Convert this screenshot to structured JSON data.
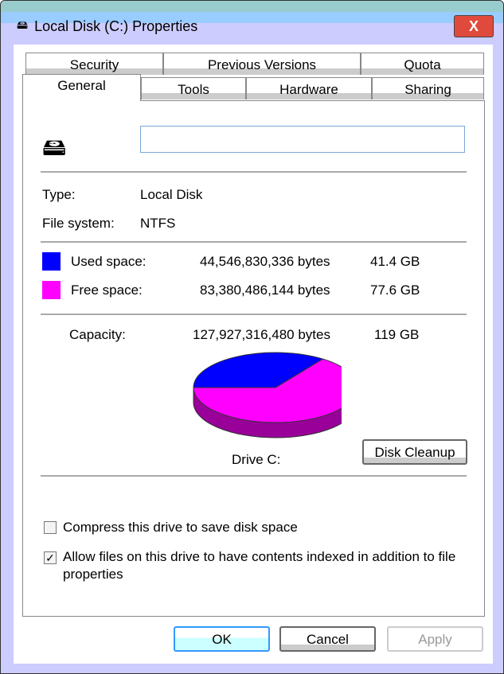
{
  "window": {
    "title": "Local Disk (C:) Properties",
    "close_label": "X"
  },
  "tabs": {
    "row1": [
      "Security",
      "Previous Versions",
      "Quota"
    ],
    "row2": [
      "General",
      "Tools",
      "Hardware",
      "Sharing"
    ],
    "active": "General"
  },
  "general": {
    "name_value": "",
    "type_label": "Type:",
    "type_value": "Local Disk",
    "fs_label": "File system:",
    "fs_value": "NTFS",
    "used_label": "Used space:",
    "used_bytes": "44,546,830,336 bytes",
    "used_gb": "41.4 GB",
    "used_color": "#0000ff",
    "free_label": "Free space:",
    "free_bytes": "83,380,486,144 bytes",
    "free_gb": "77.6 GB",
    "free_color": "#ff00ff",
    "capacity_label": "Capacity:",
    "capacity_bytes": "127,927,316,480 bytes",
    "capacity_gb": "119 GB",
    "drive_label": "Drive C:",
    "disk_cleanup_label": "Disk Cleanup",
    "compress_label": "Compress this drive to save disk space",
    "compress_checked": false,
    "index_label": "Allow files on this drive to have contents indexed in addition to file properties",
    "index_checked": true
  },
  "chart_data": {
    "type": "pie",
    "values": [
      41.4,
      77.6
    ],
    "categories": [
      "Used space",
      "Free space"
    ],
    "colors": [
      "#0000ff",
      "#ff00ff"
    ]
  },
  "buttons": {
    "ok": "OK",
    "cancel": "Cancel",
    "apply": "Apply"
  }
}
